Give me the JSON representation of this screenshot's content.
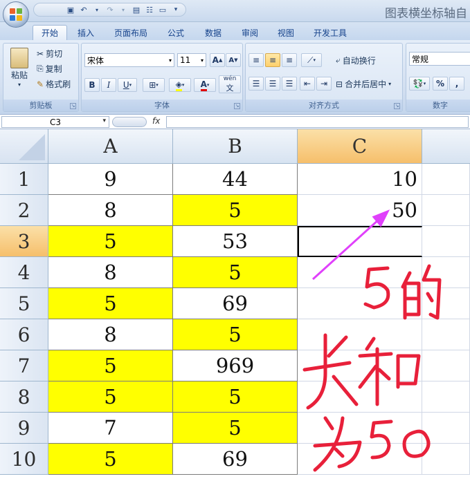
{
  "title": "图表横坐标轴自",
  "tabs": [
    "开始",
    "插入",
    "页面布局",
    "公式",
    "数据",
    "审阅",
    "视图",
    "开发工具"
  ],
  "clipboard": {
    "paste": "粘贴",
    "cut": "剪切",
    "copy": "复制",
    "format_painter": "格式刷",
    "label": "剪贴板"
  },
  "font": {
    "name": "宋体",
    "size": "11",
    "grow": "A",
    "shrink": "A",
    "bold": "B",
    "italic": "I",
    "underline": "U",
    "wen": "wén",
    "label": "字体"
  },
  "alignment": {
    "wrap": "自动换行",
    "merge": "合并后居中",
    "label": "对齐方式"
  },
  "number": {
    "format": "常规",
    "percent": "%",
    "comma": ",",
    "label": "数字"
  },
  "formula_bar": {
    "name_box": "C3",
    "fx": "fx",
    "value": ""
  },
  "columns": [
    "A",
    "B",
    "C"
  ],
  "rows": [
    {
      "n": "1",
      "a": "9",
      "b": "44",
      "c": "10"
    },
    {
      "n": "2",
      "a": "8",
      "b": "5",
      "c": "50"
    },
    {
      "n": "3",
      "a": "5",
      "b": "53",
      "c": ""
    },
    {
      "n": "4",
      "a": "8",
      "b": "5",
      "c": ""
    },
    {
      "n": "5",
      "a": "5",
      "b": "69",
      "c": ""
    },
    {
      "n": "6",
      "a": "8",
      "b": "5",
      "c": ""
    },
    {
      "n": "7",
      "a": "5",
      "b": "969",
      "c": ""
    },
    {
      "n": "8",
      "a": "5",
      "b": "5",
      "c": ""
    },
    {
      "n": "9",
      "a": "7",
      "b": "5",
      "c": ""
    },
    {
      "n": "10",
      "a": "5",
      "b": "69",
      "c": ""
    }
  ],
  "highlight": {
    "color": "#ffff00",
    "a_rows": [
      3,
      5,
      7,
      8,
      10
    ],
    "b_rows": [
      2,
      4,
      6,
      8,
      9
    ]
  },
  "selected_cell": "C3",
  "annotation": {
    "color": "#e8203a",
    "arrow_color": "#e040fb",
    "text": "5的长和为50"
  }
}
